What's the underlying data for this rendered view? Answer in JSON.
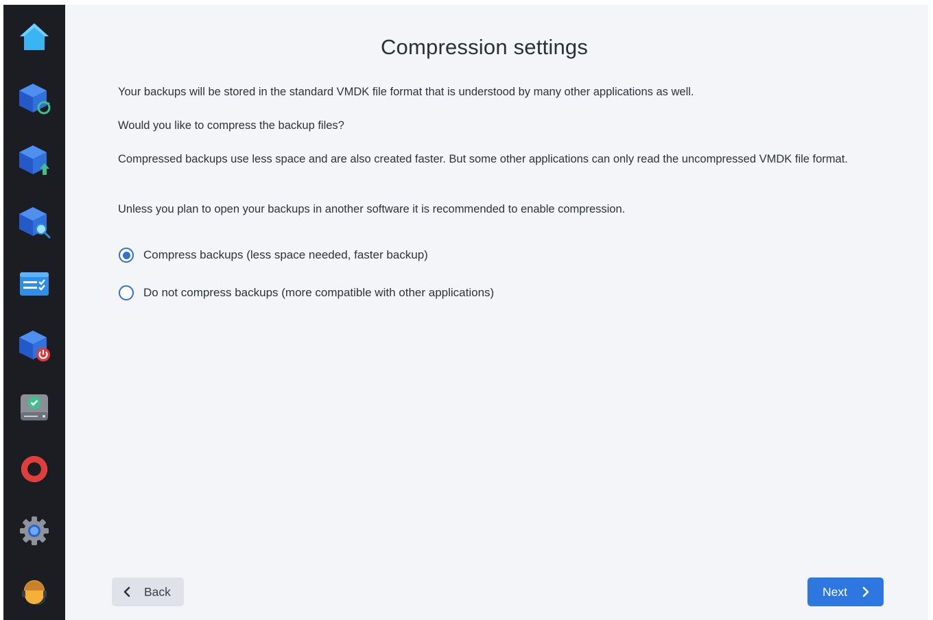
{
  "sidebar": {
    "items": [
      {
        "icon": "home-icon"
      },
      {
        "icon": "backup-restore-icon"
      },
      {
        "icon": "backup-upload-icon"
      },
      {
        "icon": "backup-search-icon"
      },
      {
        "icon": "task-list-icon"
      },
      {
        "icon": "backup-shutdown-icon"
      },
      {
        "icon": "drive-check-icon"
      },
      {
        "icon": "lifebuoy-icon"
      },
      {
        "icon": "gear-icon"
      },
      {
        "icon": "support-agent-icon"
      }
    ]
  },
  "page": {
    "title": "Compression settings",
    "paragraphs": [
      "Your backups will be stored in the standard VMDK file format that is understood by many other applications as well.",
      "Would you like to compress the backup files?",
      "Compressed backups use less space and are also created faster. But some other applications can only read the uncompressed VMDK file format.",
      "Unless you plan to open your backups in another software it is recommended to enable compression."
    ],
    "options": [
      {
        "label": "Compress backups (less space needed, faster backup)",
        "selected": true
      },
      {
        "label": "Do not compress backups (more compatible with other applications)",
        "selected": false
      }
    ]
  },
  "footer": {
    "back_label": "Back",
    "next_label": "Next"
  },
  "colors": {
    "accent": "#2f77e0",
    "sidebar_bg": "#1b1d22",
    "content_bg": "#f3f5f9"
  }
}
